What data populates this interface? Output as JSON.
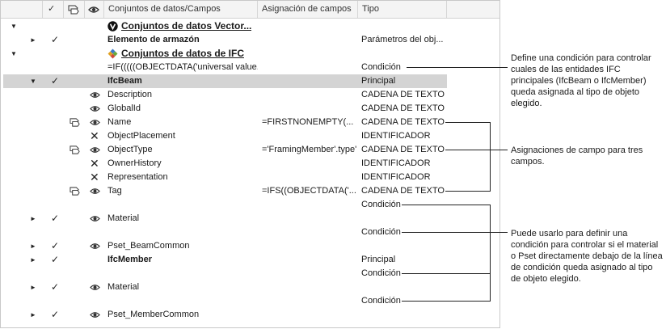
{
  "header": {
    "col_tree": "",
    "col_check_icon": "check-icon",
    "col_map_icon": "field-mapping-icon",
    "col_eye_icon": "eye-icon",
    "col_name": "Conjuntos de datos/Campos",
    "col_mapping": "Asignación de campos",
    "col_type": "Tipo"
  },
  "rows": {
    "r0": {
      "name": "Conjuntos de datos Vector...",
      "type": ""
    },
    "r1": {
      "name": "Elemento de armazón",
      "type": "Parámetros del obj..."
    },
    "r2": {
      "name": "Conjuntos de datos de IFC",
      "type": ""
    },
    "r3": {
      "name": "=IF(((((OBJECTDATA('universal value...",
      "type": "Condición"
    },
    "r4": {
      "name": "IfcBeam",
      "type": "Principal"
    },
    "r5": {
      "name": "Description",
      "type": "CADENA DE TEXTO"
    },
    "r6": {
      "name": "GlobalId",
      "type": "CADENA DE TEXTO"
    },
    "r7": {
      "name": "Name",
      "mapping": "=FIRSTNONEMPTY(...",
      "type": "CADENA DE TEXTO"
    },
    "r8": {
      "name": "ObjectPlacement",
      "type": "IDENTIFICADOR"
    },
    "r9": {
      "name": "ObjectType",
      "mapping": "='FramingMember'.type'",
      "type": "CADENA DE TEXTO"
    },
    "r10": {
      "name": "OwnerHistory",
      "type": "IDENTIFICADOR"
    },
    "r11": {
      "name": "Representation",
      "type": "IDENTIFICADOR"
    },
    "r12": {
      "name": "Tag",
      "mapping": "=IFS((OBJECTDATA('...",
      "type": "CADENA DE TEXTO"
    },
    "r13": {
      "type": "Condición"
    },
    "r14": {
      "name": "Material"
    },
    "r15": {
      "type": "Condición"
    },
    "r16": {
      "name": "Pset_BeamCommon"
    },
    "r17": {
      "name": "IfcMember",
      "type": "Principal"
    },
    "r18": {
      "type": "Condición"
    },
    "r19": {
      "name": "Material"
    },
    "r20": {
      "type": "Condición"
    },
    "r21": {
      "name": "Pset_MemberCommon"
    }
  },
  "annotations": {
    "a1": "Define una condición para controlar cuales de las entidades IFC principales (IfcBeam o IfcMember) queda asignada al tipo de objeto elegido.",
    "a2": "Asignaciones de campo para tres campos.",
    "a3": "Puede usarlo para definir una condición para controlar si el material o Pset directamente debajo de la línea de condición queda asignado al tipo de objeto elegido."
  },
  "colors": {
    "selected_row": "#d4d4d4",
    "header_bg": "#f4f4f4",
    "text": "#1a1a1a"
  }
}
